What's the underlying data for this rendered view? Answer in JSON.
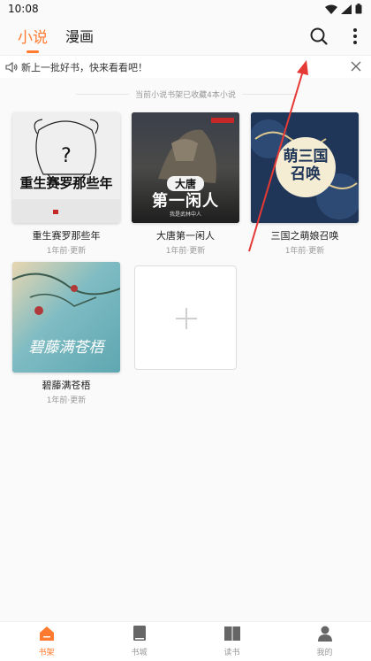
{
  "status_bar": {
    "time": "10:08"
  },
  "top_tabs": [
    {
      "label": "小说"
    },
    {
      "label": "漫画"
    }
  ],
  "notice": {
    "text": "新上一批好书，快来看看吧！"
  },
  "shelf": {
    "count_text": "当前小说书架已收藏4本小说",
    "books": [
      {
        "title": "重生赛罗那些年",
        "meta": "1年前·更新",
        "cover_text": "重生赛罗那些年"
      },
      {
        "title": "大唐第一闲人",
        "meta": "1年前·更新",
        "cover_text_top": "大唐",
        "cover_text_main": "第一闲人",
        "cover_text_sub": "我是武林中人"
      },
      {
        "title": "三国之萌娘召唤",
        "meta": "1年前·更新",
        "cover_text": "萌三国召唤"
      },
      {
        "title": "碧藤满苍梧",
        "meta": "1年前·更新",
        "cover_text": "碧藤满苍梧"
      }
    ]
  },
  "bottom_nav": [
    {
      "label": "书架",
      "icon": "home-icon",
      "active": true
    },
    {
      "label": "书城",
      "icon": "book-icon",
      "active": false
    },
    {
      "label": "读书",
      "icon": "open-book-icon",
      "active": false
    },
    {
      "label": "我的",
      "icon": "person-icon",
      "active": false
    }
  ],
  "colors": {
    "accent": "#ff7a2e",
    "annotation_arrow": "#e53935"
  }
}
